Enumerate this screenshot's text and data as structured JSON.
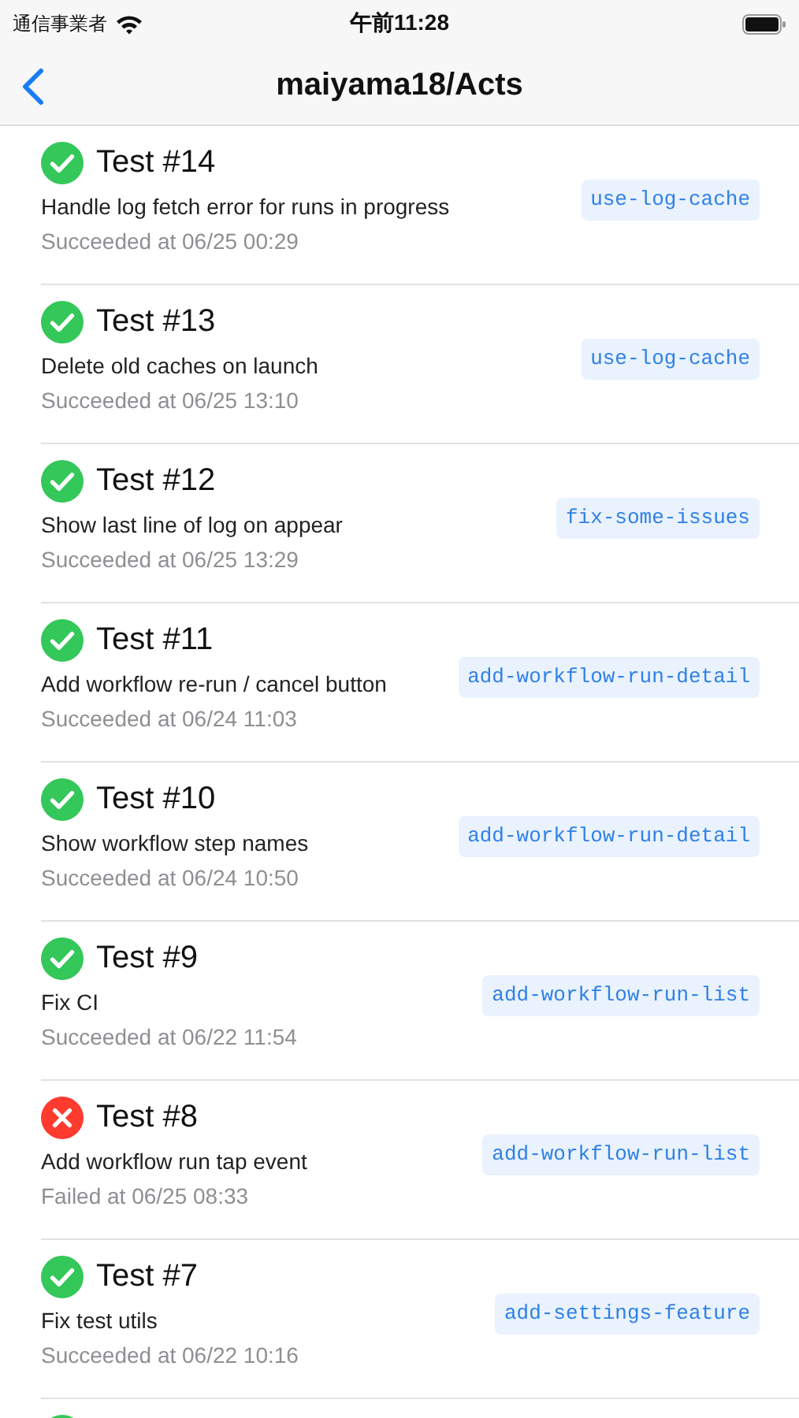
{
  "status_bar": {
    "carrier": "通信事業者",
    "time": "午前11:28"
  },
  "nav": {
    "title": "maiyama18/Acts"
  },
  "runs": [
    {
      "succeeded": true,
      "title": "Test #14",
      "message": "Handle log fetch error for runs in progress",
      "result": "Succeeded at 06/25 00:29",
      "branch": "use-log-cache"
    },
    {
      "succeeded": true,
      "title": "Test #13",
      "message": "Delete old caches on launch",
      "result": "Succeeded at 06/25 13:10",
      "branch": "use-log-cache"
    },
    {
      "succeeded": true,
      "title": "Test #12",
      "message": "Show last line of log on appear",
      "result": "Succeeded at 06/25 13:29",
      "branch": "fix-some-issues"
    },
    {
      "succeeded": true,
      "title": "Test #11",
      "message": "Add workflow re-run / cancel button",
      "result": "Succeeded at 06/24 11:03",
      "branch": "add-workflow-run-detail"
    },
    {
      "succeeded": true,
      "title": "Test #10",
      "message": "Show workflow step names",
      "result": "Succeeded at 06/24 10:50",
      "branch": "add-workflow-run-detail"
    },
    {
      "succeeded": true,
      "title": "Test #9",
      "message": "Fix CI",
      "result": "Succeeded at 06/22 11:54",
      "branch": "add-workflow-run-list"
    },
    {
      "succeeded": false,
      "title": "Test #8",
      "message": "Add workflow run tap event",
      "result": "Failed at 06/25 08:33",
      "branch": "add-workflow-run-list"
    },
    {
      "succeeded": true,
      "title": "Test #7",
      "message": "Fix test utils",
      "result": "Succeeded at 06/22 10:16",
      "branch": "add-settings-feature"
    },
    {
      "succeeded": true
    }
  ]
}
